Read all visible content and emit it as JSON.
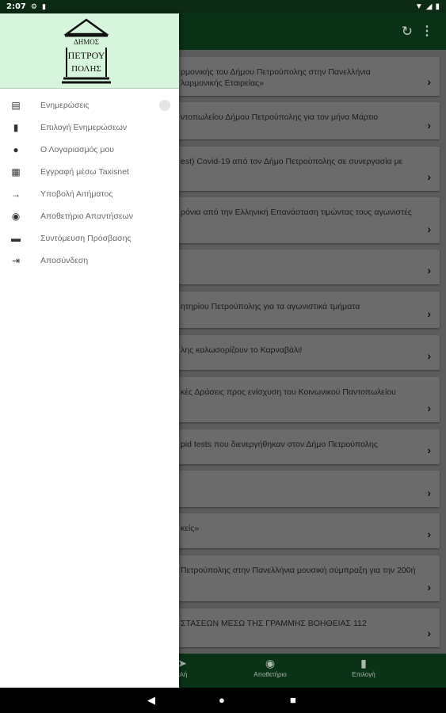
{
  "status": {
    "time": "2:07",
    "icons": [
      "settings-icon",
      "sd-card-icon",
      "wifi-icon",
      "signal-icon",
      "battery-icon"
    ]
  },
  "appbar": {
    "actions": [
      "refresh-icon",
      "more-vert-icon"
    ]
  },
  "logo": {
    "line1": "ΔΗΜΟΣ",
    "line2": "ΠΕΤΡΟΥ",
    "line3": "ΠΟΛΗΣ"
  },
  "drawer": {
    "items": [
      {
        "label": "Ενημερώσεις",
        "icon": "chat-icon"
      },
      {
        "label": "Επιλογή Ενημερώσεων",
        "icon": "bookmark-icon"
      },
      {
        "label": "Ο Λογαριασμός μου",
        "icon": "person-icon"
      },
      {
        "label": "Εγγραφή μέσω Taxisnet",
        "icon": "id-card-icon"
      },
      {
        "label": "Υποβολή Αιτήματος",
        "icon": "send-icon"
      },
      {
        "label": "Αποθετήριο Απαντήσεων",
        "icon": "eye-icon"
      },
      {
        "label": "Συντόμευση Πρόσβασης",
        "icon": "shortcut-icon"
      },
      {
        "label": "Αποσύνδεση",
        "icon": "logout-icon"
      }
    ]
  },
  "cards": [
    {
      "line1": "ρμονικής του Δήμου Πετρούπολης στην Πανελλήνια",
      "line2": "λαρμονικής Εταιρείας»"
    },
    {
      "line1": "ντοπωλείου Δήμου Πετρούπολης για τον μήνα Μάρτιο",
      "line2": ""
    },
    {
      "line1": "est) Covid-19 από τον Δήμο Πετρούπολης σε συνεργασία με",
      "line2": ""
    },
    {
      "line1": "ρόνια από την Ελληνική Επανάσταση τιμώντας τους αγωνιστές",
      "line2": ""
    },
    {
      "line1": "",
      "line2": ""
    },
    {
      "line1": "ητηρίου Πετρούπολης για τα αγωνιστικά τμήματα",
      "line2": ""
    },
    {
      "line1": "λης καλωσορίζουν το Καρναβάλι!",
      "line2": ""
    },
    {
      "line1": "κές Δράσεις προς ενίσχυση του Κοινωνικού Παντοπωλείου",
      "line2": ""
    },
    {
      "line1": "pid tests που διενεργήθηκαν στον Δήμο Πετρούπολης",
      "line2": ""
    },
    {
      "line1": "",
      "line2": ""
    },
    {
      "line1": "κείς»",
      "line2": ""
    },
    {
      "line1": "Πετρούπολης στην Πανελλήνια μουσική σύμπραξη για την 200ή",
      "line2": ""
    },
    {
      "line1": "ΣΤΑΣΕΩΝ ΜΕΣΩ ΤΗΣ ΓΡΑΜΜΗΣ ΒΟΗΘΕΙΑΣ 112",
      "line2": ""
    }
  ],
  "bottomnav": [
    {
      "label": "ολή",
      "icon": "send-icon"
    },
    {
      "label": "Αποθετήριο",
      "icon": "eye-icon"
    },
    {
      "label": "Επιλογή",
      "icon": "bookmark-icon"
    }
  ],
  "colors": {
    "drawer_header": "#d7f5dc",
    "appbar": "#0a3216",
    "scrim_content": "#5c5c5c"
  }
}
